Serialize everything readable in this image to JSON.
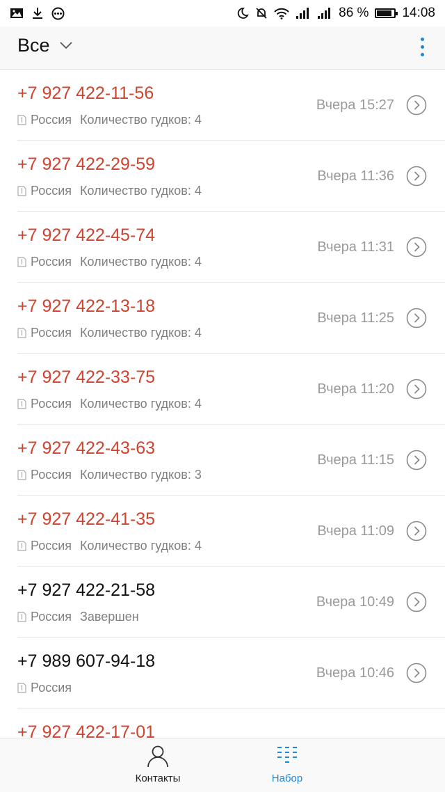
{
  "status_bar": {
    "battery_percent": "86 %",
    "battery_level": 0.86,
    "time": "14:08",
    "left_icons": [
      "image-icon",
      "download-icon",
      "more-circle-icon"
    ],
    "right_icons": [
      "moon-icon",
      "mute-icon",
      "wifi-icon",
      "signal-icon",
      "signal-icon"
    ]
  },
  "header": {
    "filter_label": "Все",
    "menu_icon": "more-vert-icon",
    "accent_color": "#1e88d8"
  },
  "colors": {
    "missed": "#d0432f",
    "normal": "#111111",
    "muted": "#9a9a9a"
  },
  "calls": [
    {
      "number": "+7 927 422-11-56",
      "region": "Россия",
      "status": "Количество гудков: 4",
      "time": "Вчера 15:27",
      "missed": true
    },
    {
      "number": "+7 927 422-29-59",
      "region": "Россия",
      "status": "Количество гудков: 4",
      "time": "Вчера 11:36",
      "missed": true
    },
    {
      "number": "+7 927 422-45-74",
      "region": "Россия",
      "status": "Количество гудков: 4",
      "time": "Вчера 11:31",
      "missed": true
    },
    {
      "number": "+7 927 422-13-18",
      "region": "Россия",
      "status": "Количество гудков: 4",
      "time": "Вчера 11:25",
      "missed": true
    },
    {
      "number": "+7 927 422-33-75",
      "region": "Россия",
      "status": "Количество гудков: 4",
      "time": "Вчера 11:20",
      "missed": true
    },
    {
      "number": "+7 927 422-43-63",
      "region": "Россия",
      "status": "Количество гудков: 3",
      "time": "Вчера 11:15",
      "missed": true
    },
    {
      "number": "+7 927 422-41-35",
      "region": "Россия",
      "status": "Количество гудков: 4",
      "time": "Вчера 11:09",
      "missed": true
    },
    {
      "number": "+7 927 422-21-58",
      "region": "Россия",
      "status": "Завершен",
      "time": "Вчера 10:49",
      "missed": false
    },
    {
      "number": "+7 989 607-94-18",
      "region": "Россия",
      "status": "",
      "time": "Вчера 10:46",
      "missed": false
    },
    {
      "number": "+7 927 422-17-01",
      "region": "",
      "status": "",
      "time": "",
      "missed": true
    }
  ],
  "bottom_nav": {
    "contacts_label": "Контакты",
    "dialer_label": "Набор",
    "active_tab": "dialer"
  }
}
